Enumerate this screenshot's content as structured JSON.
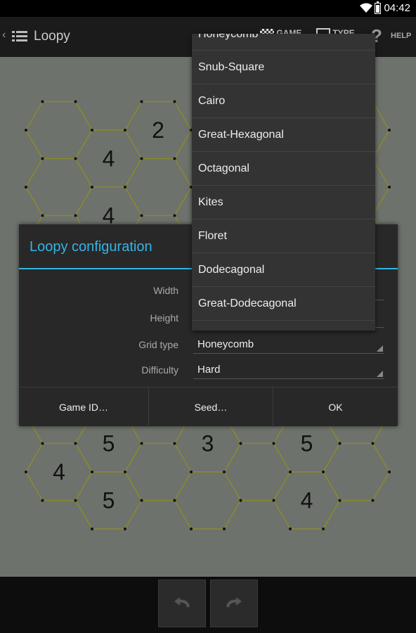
{
  "status_bar": {
    "time": "04:42",
    "wifi_icon": "wifi-icon",
    "battery_icon": "battery-icon"
  },
  "action_bar": {
    "title": "Loopy",
    "up_icon": "back-caret-icon",
    "app_icon": "list-icon",
    "game_action_label": "GAME",
    "type_action_label": "TYPE",
    "help_label": "HELP"
  },
  "board": {
    "line_color": "#8c8a2c",
    "clues": [
      {
        "text": "2"
      },
      {
        "text": "4"
      },
      {
        "text": "4"
      },
      {
        "text": "5"
      },
      {
        "text": "3"
      },
      {
        "text": "5"
      },
      {
        "text": "4"
      },
      {
        "text": "5"
      },
      {
        "text": "4"
      }
    ]
  },
  "dialog": {
    "title": "Loopy configuration",
    "fields": [
      {
        "label": "Width",
        "value": ""
      },
      {
        "label": "Height",
        "value": ""
      },
      {
        "label": "Grid type",
        "value": "Honeycomb"
      },
      {
        "label": "Difficulty",
        "value": "Hard"
      }
    ],
    "buttons": {
      "game_id": "Game ID…",
      "seed": "Seed…",
      "ok": "OK"
    }
  },
  "dropdown": {
    "partial_top_item": "Honeycomb",
    "items": [
      "Snub-Square",
      "Cairo",
      "Great-Hexagonal",
      "Octagonal",
      "Kites",
      "Floret",
      "Dodecagonal",
      "Great-Dodecagonal"
    ]
  },
  "bottom_bar": {
    "undo_icon": "undo-icon",
    "redo_icon": "redo-icon"
  },
  "colors": {
    "accent": "#33b5e5",
    "board_bg": "#6d726c",
    "dialog_bg": "#282828"
  }
}
